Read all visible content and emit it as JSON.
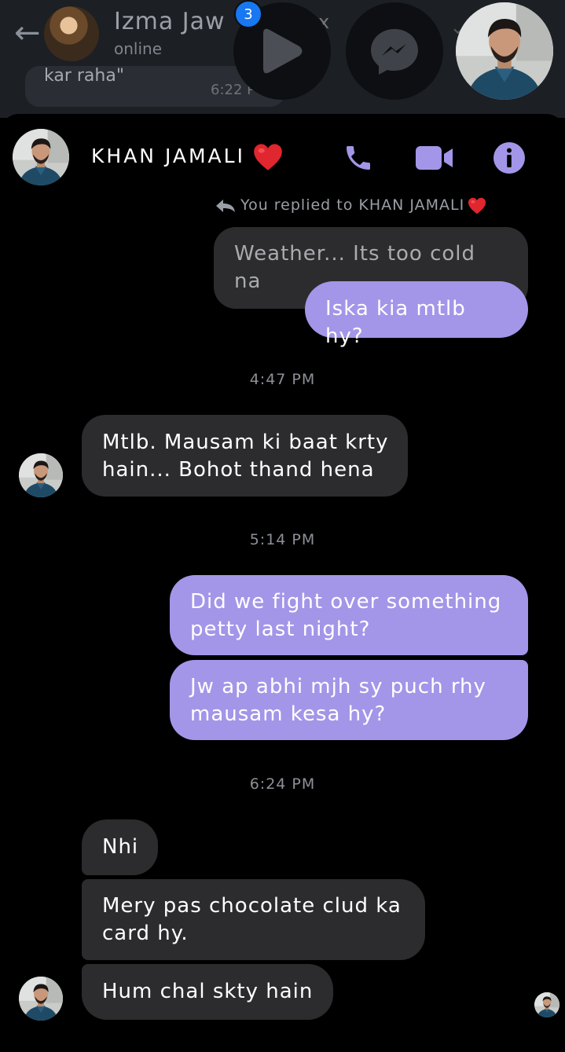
{
  "background_app": {
    "contact_name": "Izma Jaw",
    "status": "online",
    "close_glyph": "x",
    "last_message": "kar raha\"",
    "last_time": "6:22 P"
  },
  "bubbles_overlay": {
    "unread_count": "3"
  },
  "chat_header": {
    "contact_name": "KHAN JAMALI",
    "icons": [
      "phone-icon",
      "video-camera-icon",
      "info-icon"
    ],
    "accent_color": "#a396e8"
  },
  "reply_context": {
    "label": "You replied to KHAN JAMALI",
    "quoted_text": "Weather... Its too cold na"
  },
  "messages": [
    {
      "type": "outgoing",
      "text": "Iska kia mtlb hy?"
    },
    {
      "type": "timestamp",
      "text": "4:47 PM"
    },
    {
      "type": "incoming",
      "text": "Mtlb. Mausam ki baat krty hain... Bohot thand hena"
    },
    {
      "type": "timestamp",
      "text": "5:14 PM"
    },
    {
      "type": "outgoing",
      "text": "Did we fight over something petty last night?"
    },
    {
      "type": "outgoing",
      "text": "Jw ap abhi mjh sy puch rhy mausam kesa hy?"
    },
    {
      "type": "timestamp",
      "text": "6:24 PM"
    },
    {
      "type": "incoming",
      "text": "Nhi"
    },
    {
      "type": "incoming",
      "text": "Mery pas chocolate clud ka card hy."
    },
    {
      "type": "incoming",
      "text": "Hum chal skty hain"
    }
  ],
  "colors": {
    "outgoing_bubble": "#a396e8",
    "incoming_bubble": "#2c2c2e",
    "background": "#000000",
    "heart": "#e0262e"
  }
}
